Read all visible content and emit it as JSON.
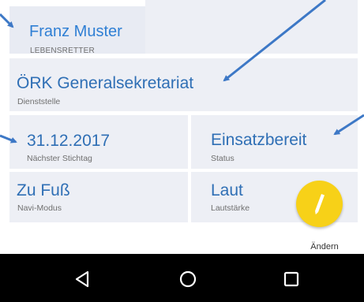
{
  "profile": {
    "name": "Franz Muster",
    "role": "LEBENSRETTER"
  },
  "station": {
    "value": "ÖRK Generalsekretariat",
    "label": "Dienststelle"
  },
  "deadline": {
    "value": "31.12.2017",
    "label": "Nächster Stichtag"
  },
  "status": {
    "value": "Einsatzbereit",
    "label": "Status"
  },
  "navigation_mode": {
    "value": "Zu Fuß",
    "label": "Navi-Modus"
  },
  "volume": {
    "value": "Laut",
    "label": "Lautstärke"
  },
  "edit": {
    "label": "Ändern",
    "icon": "pencil-icon",
    "color": "#f7d118"
  },
  "system_nav": {
    "back_icon": "back-triangle-icon",
    "home_icon": "home-circle-icon",
    "recents_icon": "recents-square-icon"
  },
  "colors": {
    "primary_text": "#2f6fb5",
    "card_background": "#edeff5",
    "annotation_arrow": "#3d78c6"
  }
}
